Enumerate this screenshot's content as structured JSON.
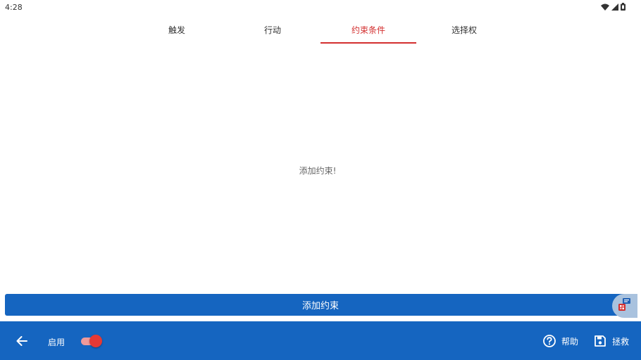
{
  "status_bar": {
    "time": "4:28",
    "icons": [
      "wifi-icon",
      "signal-icon",
      "battery-icon"
    ]
  },
  "tabs": [
    {
      "label": "触发",
      "active": false
    },
    {
      "label": "行动",
      "active": false
    },
    {
      "label": "约束条件",
      "active": true
    },
    {
      "label": "选择权",
      "active": false
    }
  ],
  "main": {
    "empty_message": "添加约束!"
  },
  "add_button": {
    "label": "添加约束"
  },
  "bottom_bar": {
    "enable_label": "启用",
    "enabled": true,
    "help_label": "帮助",
    "rescue_label": "拯救"
  },
  "colors": {
    "accent": "#d32f2f",
    "primary": "#1565c0",
    "toggle_thumb": "#e53935"
  }
}
